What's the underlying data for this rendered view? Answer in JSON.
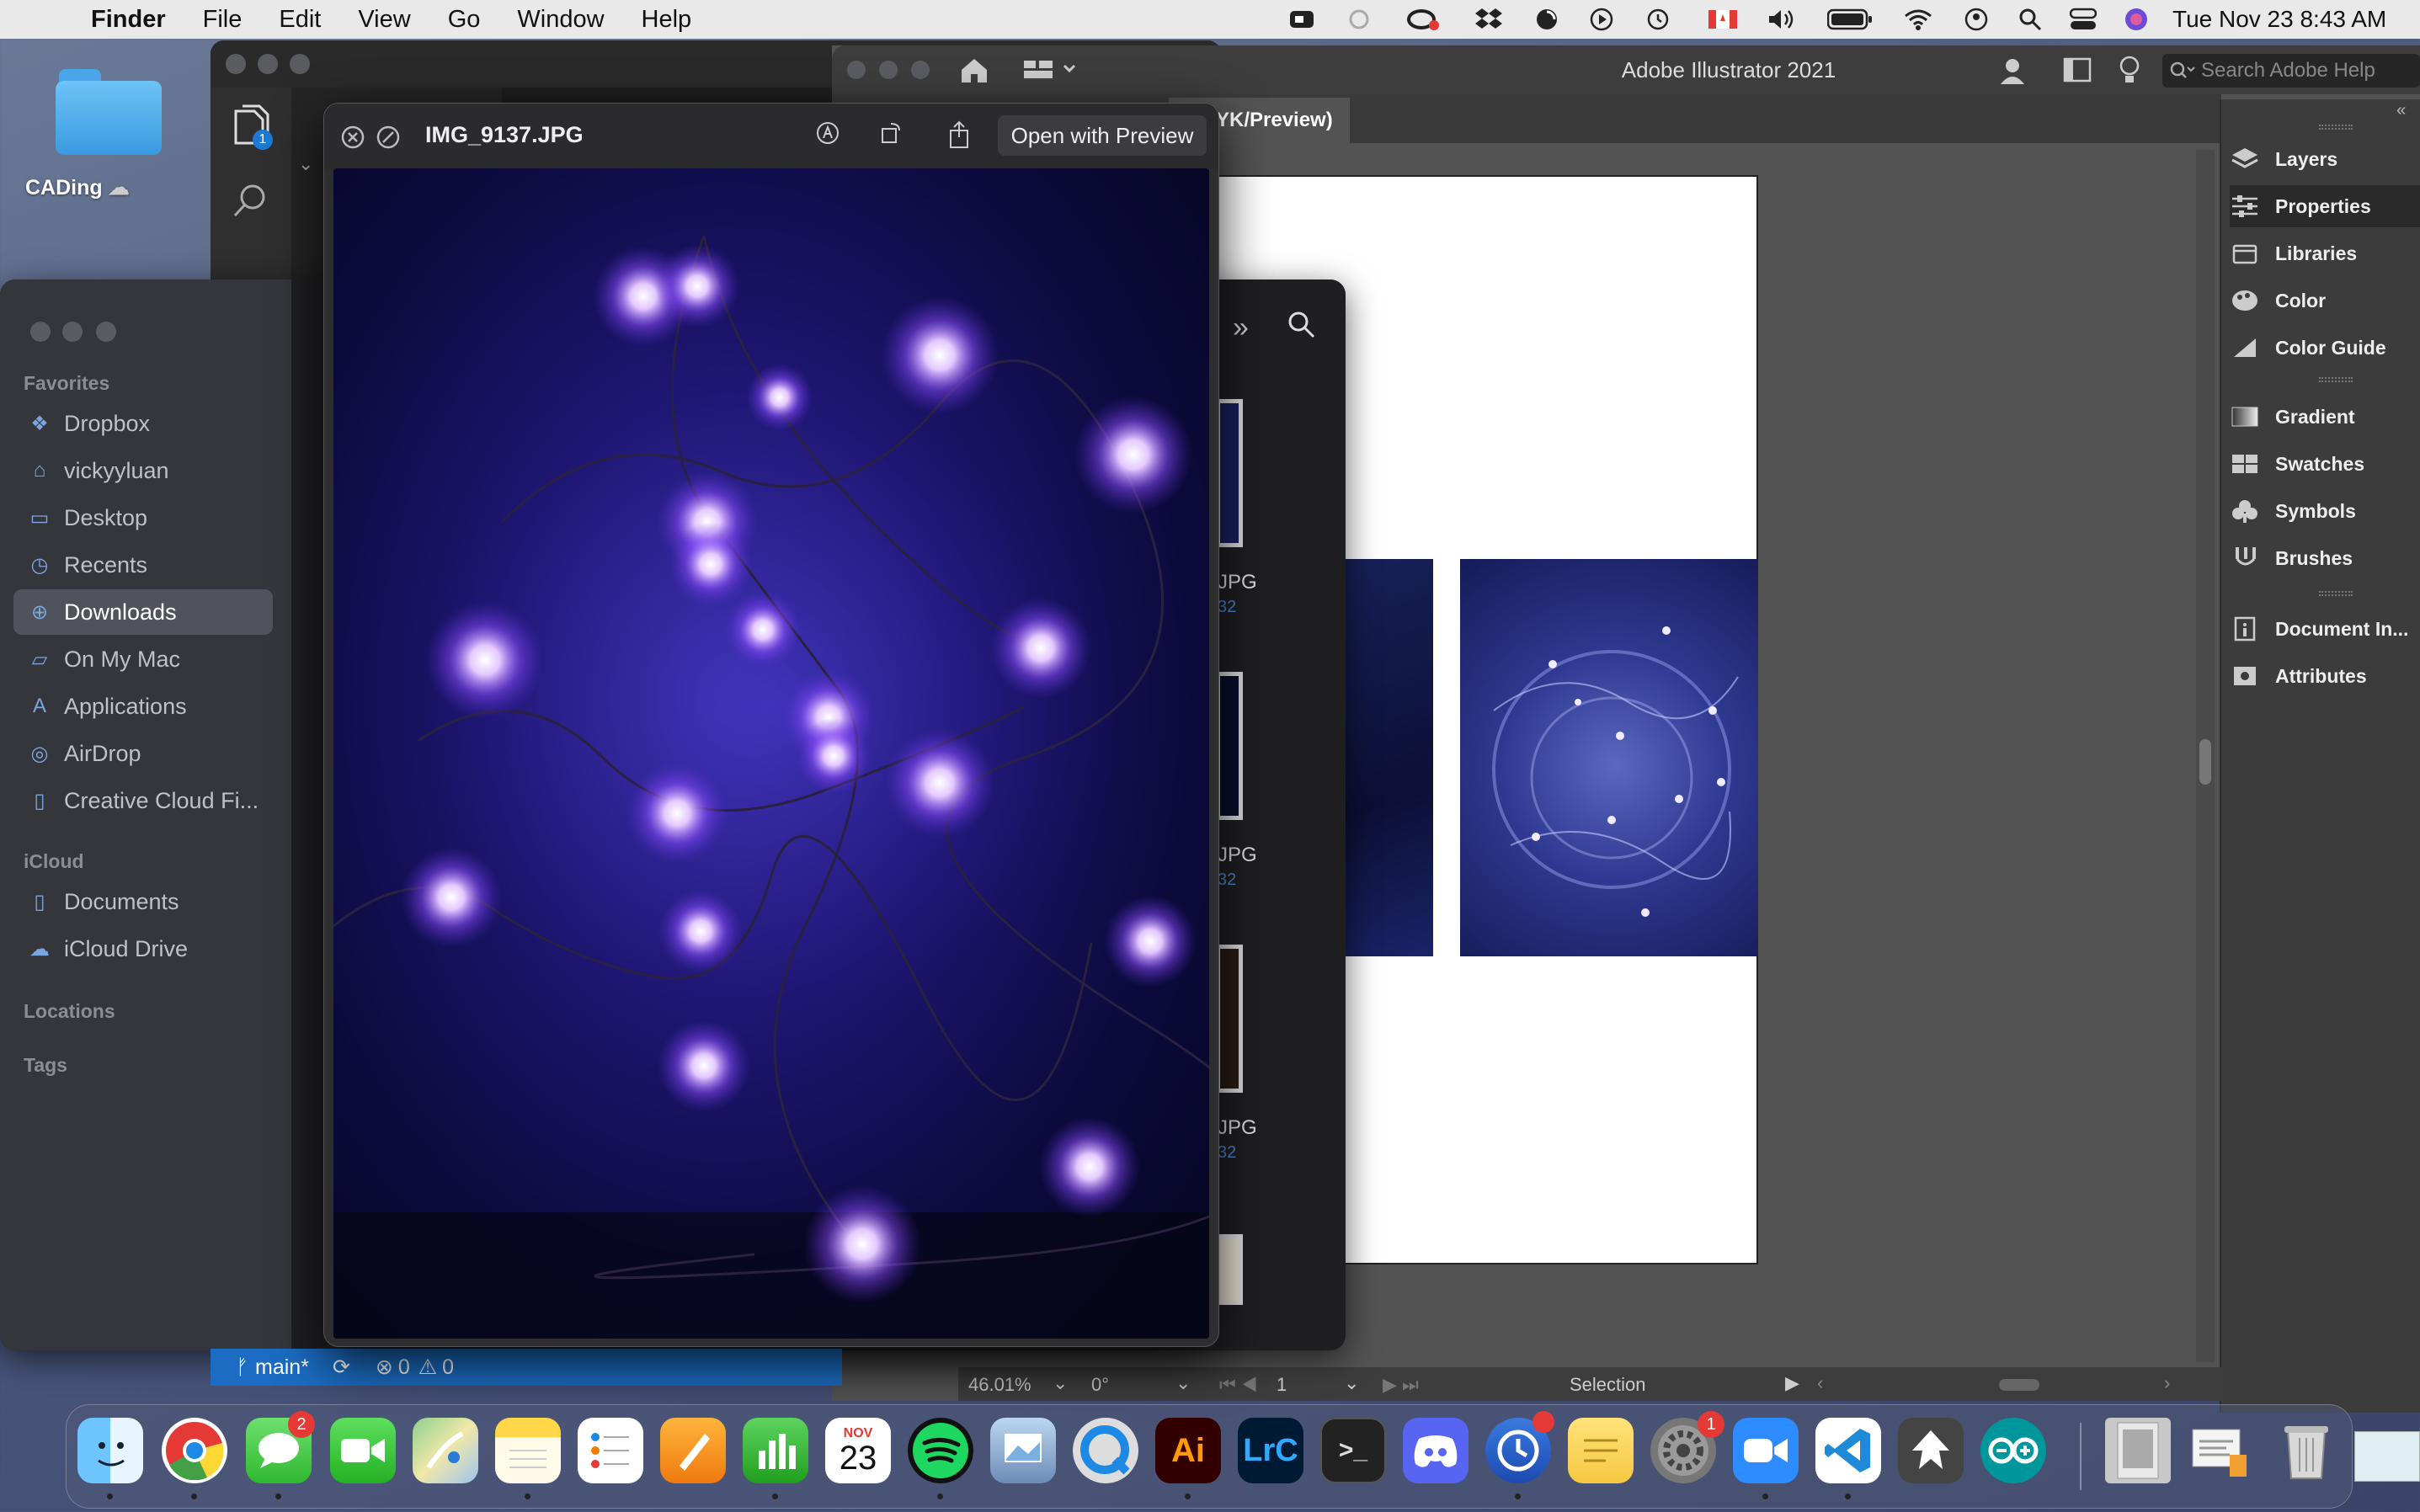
{
  "menubar": {
    "app": "Finder",
    "items": [
      "File",
      "Edit",
      "View",
      "Go",
      "Window",
      "Help"
    ],
    "clock": "Tue Nov 23  8:43 AM"
  },
  "desktop": {
    "folder_label": "CADing"
  },
  "illustrator": {
    "title": "Adobe Illustrator 2021",
    "search_placeholder": "Search Adobe Help",
    "doc_tab": "MYK/Preview)",
    "zoom": "46.01%",
    "rotation": "0°",
    "artboard": "1",
    "tool": "Selection",
    "panels": [
      "Layers",
      "Properties",
      "Libraries",
      "Color",
      "Color Guide",
      "Gradient",
      "Swatches",
      "Symbols",
      "Brushes",
      "Document In...",
      "Attributes"
    ]
  },
  "finder": {
    "favorites_header": "Favorites",
    "favorites": [
      {
        "label": "Dropbox",
        "icon": "dropbox-icon"
      },
      {
        "label": "vickyyluan",
        "icon": "home-icon"
      },
      {
        "label": "Desktop",
        "icon": "desktop-icon"
      },
      {
        "label": "Recents",
        "icon": "clock-icon"
      },
      {
        "label": "Downloads",
        "icon": "download-icon"
      },
      {
        "label": "On My Mac",
        "icon": "folder-icon"
      },
      {
        "label": "Applications",
        "icon": "applications-icon"
      },
      {
        "label": "AirDrop",
        "icon": "airdrop-icon"
      },
      {
        "label": "Creative Cloud Fi...",
        "icon": "document-icon"
      }
    ],
    "icloud_header": "iCloud",
    "icloud": [
      {
        "label": "Documents",
        "icon": "document-icon"
      },
      {
        "label": "iCloud Drive",
        "icon": "cloud-icon"
      }
    ],
    "locations_header": "Locations",
    "tags_header": "Tags",
    "files": [
      {
        "label": "JPG",
        "sub": "32"
      },
      {
        "label": "JPG",
        "sub": "32"
      },
      {
        "label": "JPG",
        "sub": "32"
      }
    ]
  },
  "quicklook": {
    "title": "IMG_9137.JPG",
    "open_button": "Open with Preview"
  },
  "vscode": {
    "branch": "main*",
    "errors": "0",
    "warnings": "0",
    "explorer_badge": "1"
  },
  "dock": {
    "calendar_month": "NOV",
    "calendar_day": "23",
    "messages_badge": "2",
    "system_prefs_badge": "1",
    "apps": [
      "Finder",
      "Chrome",
      "Messages",
      "FaceTime",
      "Maps",
      "Notes",
      "Reminders",
      "Pages",
      "Numbers",
      "Calendar",
      "Spotify",
      "Preview",
      "QuickTime",
      "Illustrator",
      "Lightroom Classic",
      "Terminal",
      "Discord",
      "Time Tracker",
      "Stickies",
      "System Preferences",
      "Zoom",
      "VS Code",
      "Inkscape",
      "Arduino"
    ],
    "illustrator_label": "Ai",
    "lightroom_label": "LrC",
    "terminal_label": ">_"
  }
}
